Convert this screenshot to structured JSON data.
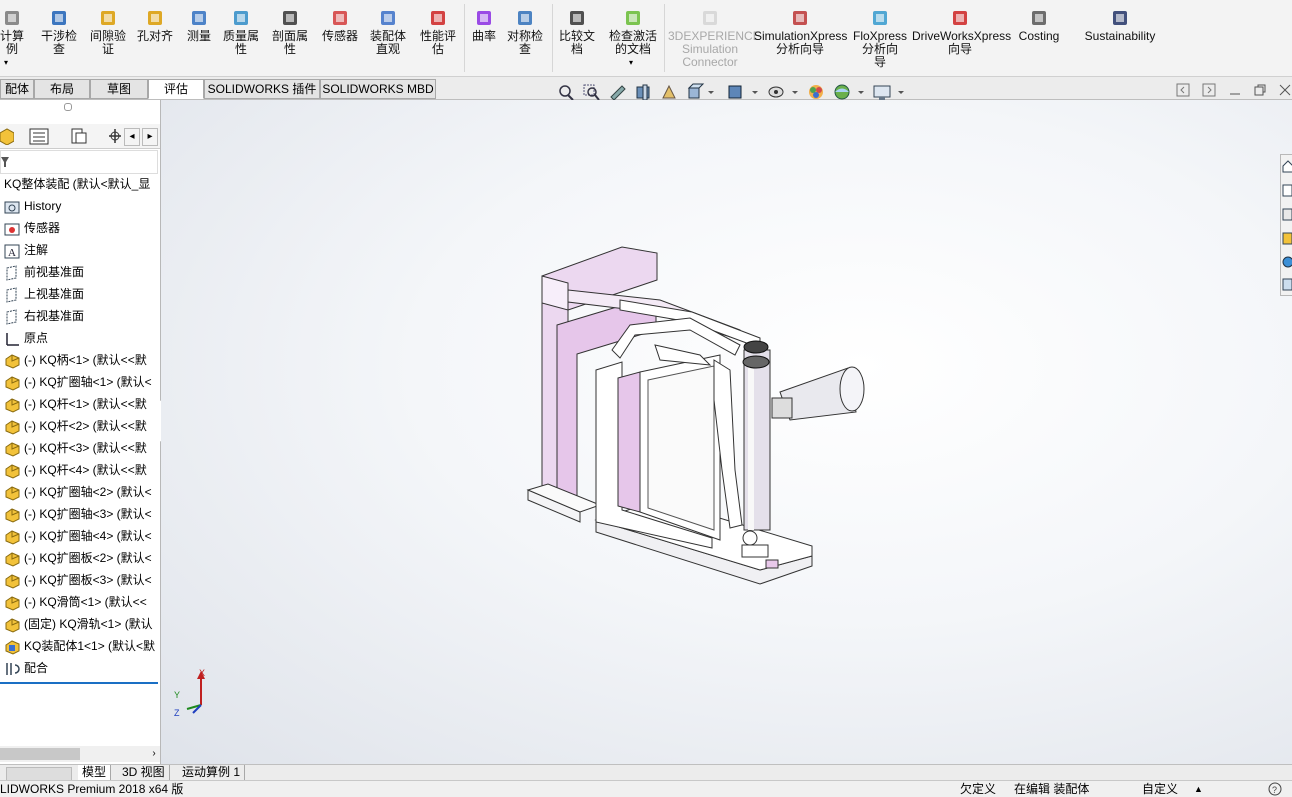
{
  "ribbon": {
    "buttons": [
      {
        "label": "计算\n例",
        "icon": "calculator-icon"
      },
      {
        "label": "干涉检\n查",
        "icon": "interference-check-icon"
      },
      {
        "label": "间隙验\n证",
        "icon": "clearance-verification-icon"
      },
      {
        "label": "孔对齐",
        "icon": "hole-alignment-icon"
      },
      {
        "label": "测量",
        "icon": "measure-icon"
      },
      {
        "label": "质量属\n性",
        "icon": "mass-properties-icon"
      },
      {
        "label": "剖面属\n性",
        "icon": "section-properties-icon"
      },
      {
        "label": "传感器",
        "icon": "sensor-icon"
      },
      {
        "label": "装配体\n直观",
        "icon": "assembly-visualization-icon"
      },
      {
        "label": "性能评\n估",
        "icon": "performance-evaluation-icon"
      },
      {
        "label": "曲率",
        "icon": "curvature-icon"
      },
      {
        "label": "对称检\n查",
        "icon": "symmetry-check-icon"
      },
      {
        "label": "比较文\n档",
        "icon": "compare-documents-icon"
      },
      {
        "label": "检查激活\n的文档",
        "icon": "check-active-document-icon"
      },
      {
        "label": "3DEXPERIENCE\nSimulation\nConnector",
        "icon": "3dexperience-icon"
      },
      {
        "label": "SimulationXpress\n分析向导",
        "icon": "simulationxpress-icon"
      },
      {
        "label": "FloXpress\n分析向\n导",
        "icon": "floxpress-icon"
      },
      {
        "label": "DriveWorksXpress\n向导",
        "icon": "driveworksxpress-icon"
      },
      {
        "label": "Costing",
        "icon": "costing-icon"
      },
      {
        "label": "Sustainability",
        "icon": "sustainability-icon"
      }
    ]
  },
  "tabs": [
    "配体",
    "布局",
    "草图",
    "评估",
    "SOLIDWORKS 插件",
    "SOLIDWORKS MBD"
  ],
  "active_tab": "评估",
  "tree": {
    "root": "KQ整体装配 (默认<默认_显",
    "items": [
      {
        "label": "History",
        "icon": "history-folder-icon"
      },
      {
        "label": "传感器",
        "icon": "sensor-folder-icon"
      },
      {
        "label": "注解",
        "icon": "annotation-icon"
      },
      {
        "label": "前视基准面",
        "icon": "plane-icon"
      },
      {
        "label": "上视基准面",
        "icon": "plane-icon"
      },
      {
        "label": "右视基准面",
        "icon": "plane-icon"
      },
      {
        "label": "原点",
        "icon": "origin-icon"
      },
      {
        "label": "(-) KQ柄<1> (默认<<默",
        "icon": "part-icon"
      },
      {
        "label": "(-) KQ扩圈轴<1> (默认<",
        "icon": "part-icon"
      },
      {
        "label": "(-) KQ杆<1> (默认<<默",
        "icon": "part-icon"
      },
      {
        "label": "(-) KQ杆<2> (默认<<默",
        "icon": "part-icon"
      },
      {
        "label": "(-) KQ杆<3> (默认<<默",
        "icon": "part-icon"
      },
      {
        "label": "(-) KQ杆<4> (默认<<默",
        "icon": "part-icon"
      },
      {
        "label": "(-) KQ扩圈轴<2> (默认<",
        "icon": "part-icon"
      },
      {
        "label": "(-) KQ扩圈轴<3> (默认<",
        "icon": "part-icon"
      },
      {
        "label": "(-) KQ扩圈轴<4> (默认<",
        "icon": "part-icon"
      },
      {
        "label": "(-) KQ扩圈板<2> (默认<",
        "icon": "part-icon"
      },
      {
        "label": "(-) KQ扩圈板<3> (默认<",
        "icon": "part-icon"
      },
      {
        "label": "(-) KQ滑筒<1> (默认<<",
        "icon": "part-icon"
      },
      {
        "label": "(固定) KQ滑轨<1> (默认",
        "icon": "part-icon"
      },
      {
        "label": "KQ装配体1<1> (默认<默",
        "icon": "subassembly-icon"
      },
      {
        "label": "配合",
        "icon": "mates-icon"
      }
    ]
  },
  "bottom_tabs": [
    "模型",
    "3D 视图",
    "运动算例 1"
  ],
  "status": {
    "product": "LIDWORKS Premium 2018 x64 版",
    "definition": "欠定义",
    "mode": "在编辑 装配体",
    "units": "自定义"
  },
  "triad": {
    "x": "X",
    "y": "Y",
    "z": "Z"
  },
  "colors": {
    "accent": "#1a6fc4",
    "part_pink": "#e8c8ea"
  }
}
